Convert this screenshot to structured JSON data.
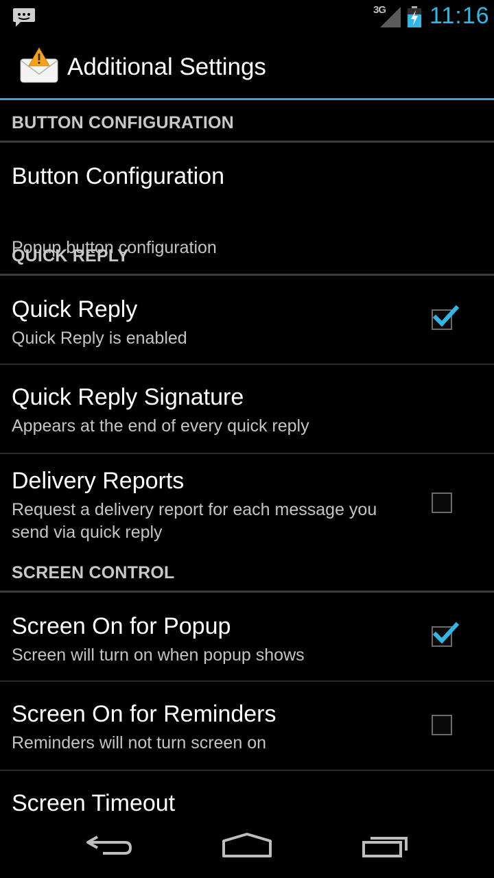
{
  "status_bar": {
    "network": "3G",
    "time": "11:16",
    "icons": [
      "chat-notification-icon",
      "signal-icon",
      "battery-charging-icon"
    ]
  },
  "action_bar": {
    "title": "Additional Settings",
    "app_icon": "envelope-warning-icon"
  },
  "sections": {
    "button_config": {
      "header": "BUTTON CONFIGURATION",
      "items": [
        {
          "title": "Button Configuration",
          "summary": "Popup button configuration"
        }
      ]
    },
    "quick_reply": {
      "header": "QUICK REPLY",
      "items": [
        {
          "title": "Quick Reply",
          "summary": "Quick Reply is enabled",
          "checked": true
        },
        {
          "title": "Quick Reply Signature",
          "summary": "Appears at the end of every quick reply"
        },
        {
          "title": "Delivery Reports",
          "summary": "Request a delivery report for each message you send via quick reply",
          "checked": false
        }
      ]
    },
    "screen_control": {
      "header": "SCREEN CONTROL",
      "items": [
        {
          "title": "Screen On for Popup",
          "summary": "Screen will turn on when popup shows",
          "checked": true
        },
        {
          "title": "Screen On for Reminders",
          "summary": "Reminders will not turn screen on",
          "checked": false
        },
        {
          "title": "Screen Timeout"
        }
      ]
    }
  },
  "nav_bar": {
    "buttons": [
      "back-icon",
      "home-icon",
      "recent-apps-icon"
    ]
  },
  "colors": {
    "accent": "#33b5e5",
    "divider_accent": "#3aa0d8",
    "background": "#000000"
  }
}
